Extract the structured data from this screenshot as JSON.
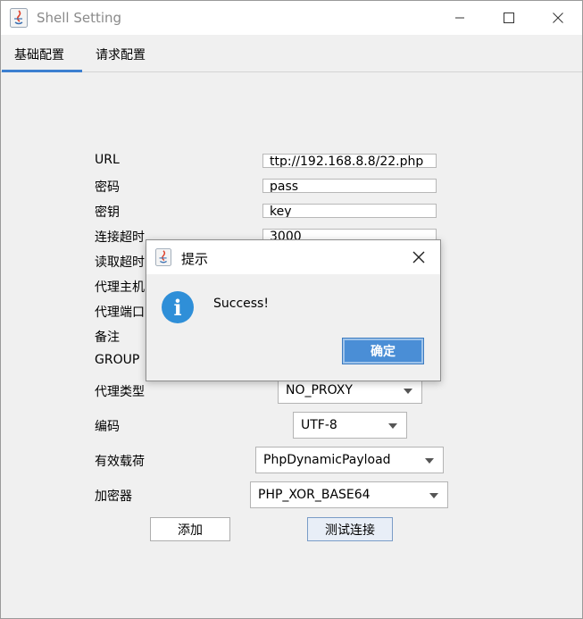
{
  "window": {
    "title": "Shell Setting"
  },
  "tabs": [
    {
      "label": "基础配置"
    },
    {
      "label": "请求配置"
    }
  ],
  "form": {
    "url_label": "URL",
    "url_value": "ttp://192.168.8.8/22.php",
    "password_label": "密码",
    "password_value": "pass",
    "key_label": "密钥",
    "key_value": "key",
    "connect_timeout_label": "连接超时",
    "connect_timeout_value": "3000",
    "read_timeout_label": "读取超时",
    "proxy_host_label": "代理主机",
    "proxy_port_label": "代理端口",
    "remark_label": "备注",
    "group_label": "GROUP",
    "proxy_type_label": "代理类型",
    "proxy_type_value": "NO_PROXY",
    "encoding_label": "编码",
    "encoding_value": "UTF-8",
    "payload_label": "有效载荷",
    "payload_value": "PhpDynamicPayload",
    "cryption_label": "加密器",
    "cryption_value": "PHP_XOR_BASE64",
    "add_button": "添加",
    "test_button": "测试连接"
  },
  "dialog": {
    "title": "提示",
    "message": "Success!",
    "ok_button": "确定",
    "icon": "info-icon"
  },
  "colors": {
    "accent": "#3c7fd0",
    "ok_button": "#4a8ed6",
    "info_icon": "#2f8fd8"
  }
}
